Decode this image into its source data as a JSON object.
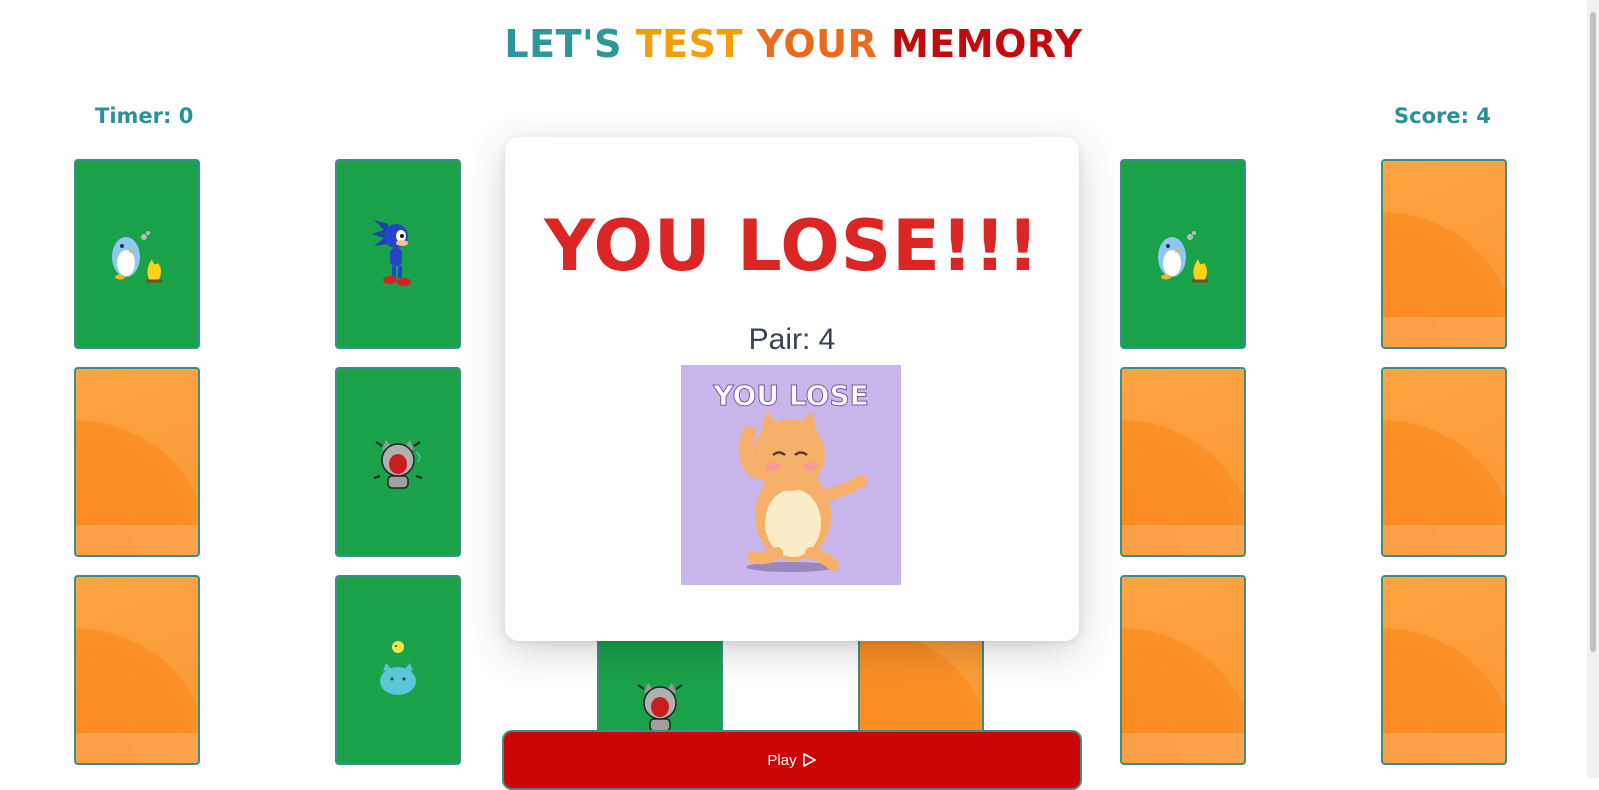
{
  "header": {
    "title_words": [
      {
        "text": "LET'S",
        "color": "#2e979a"
      },
      {
        "text": "TEST",
        "color": "#f59e0b"
      },
      {
        "text": "YOUR",
        "color": "#ea6a1e"
      },
      {
        "text": "MEMORY",
        "color": "#c40a0a"
      }
    ]
  },
  "stats": {
    "timer_label": "Timer: 0",
    "score_label": "Score: 4"
  },
  "cards": [
    {
      "state": "face",
      "icon": "penguin-campfire-icon"
    },
    {
      "state": "face",
      "icon": "sonic-hedgehog-icon"
    },
    {
      "state": "face",
      "icon": "penguin-campfire-icon"
    },
    {
      "state": "back"
    },
    {
      "state": "back"
    },
    {
      "state": "face",
      "icon": "screaming-cat-icon"
    },
    {
      "state": "back"
    },
    {
      "state": "back"
    },
    {
      "state": "back"
    },
    {
      "state": "face",
      "icon": "blue-creature-chick-icon"
    },
    {
      "state": "face",
      "icon": "screaming-cat-icon"
    },
    {
      "state": "back"
    },
    {
      "state": "back"
    },
    {
      "state": "back"
    }
  ],
  "modal": {
    "title": "YOU LOSE!!!",
    "pair_label": "Pair: 4",
    "image_text": "YOU LOSE",
    "image_icon": "dancing-hamster-icon"
  },
  "play_button": {
    "label": "Play",
    "icon": "play-triangle-icon"
  },
  "colors": {
    "card_face": "#1aa24a",
    "card_back": "#fb9730",
    "lose_red": "#dc2626",
    "button_red": "#cc0606",
    "accent_teal": "#2b9199"
  }
}
